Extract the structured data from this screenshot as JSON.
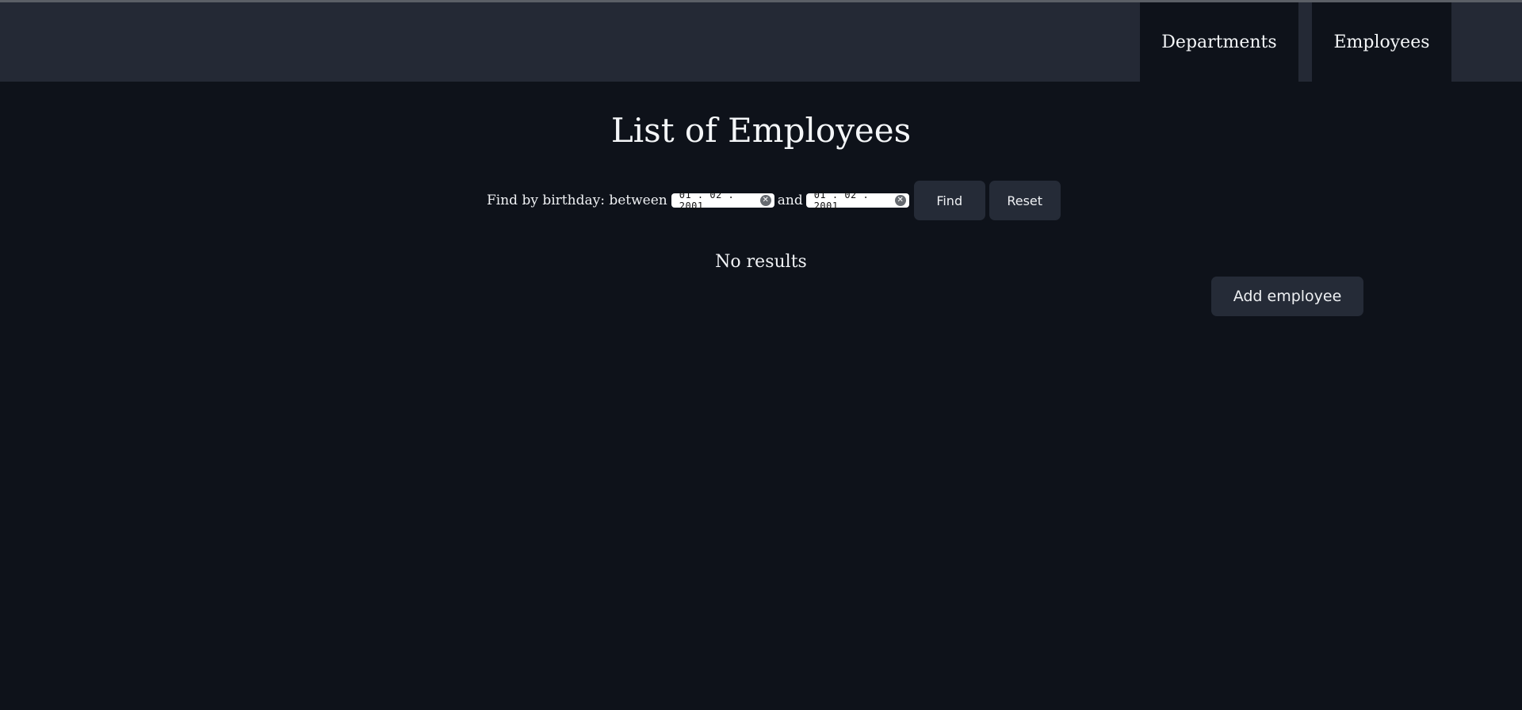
{
  "nav": {
    "tabs": [
      {
        "label": "Departments"
      },
      {
        "label": "Employees"
      }
    ]
  },
  "main": {
    "title": "List of Employees",
    "filter": {
      "label": "Find by birthday: between",
      "and_label": "and",
      "date_from": "01 . 02 . 2001",
      "date_to": "01 . 02 . 2001",
      "find_label": "Find",
      "reset_label": "Reset"
    },
    "no_results": "No results",
    "add_employee_label": "Add employee"
  },
  "colors": {
    "background": "#0e121a",
    "navbar": "#242935",
    "button": "#252b37"
  }
}
